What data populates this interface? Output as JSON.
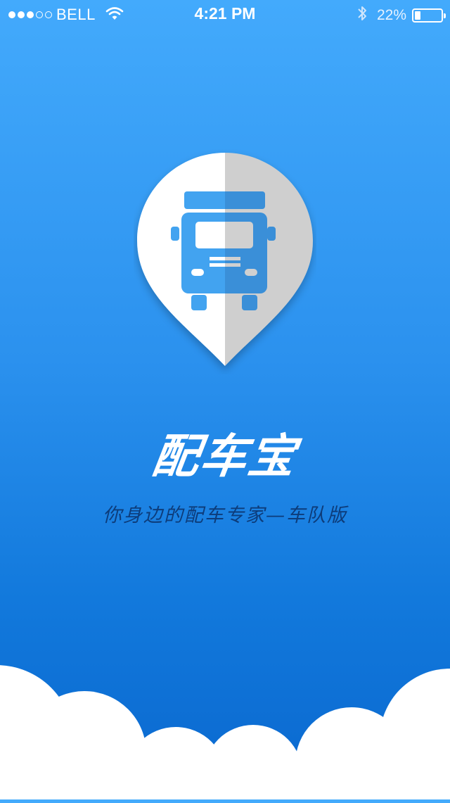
{
  "status_bar": {
    "signal_filled": 3,
    "signal_total": 5,
    "carrier": "BELL",
    "time": "4:21 PM",
    "battery_percent": "22%",
    "battery_level": 0.22,
    "icons": [
      "wifi-icon",
      "bluetooth-icon",
      "battery-icon"
    ]
  },
  "splash": {
    "logo_icon": "truck-location-pin-icon",
    "app_name": "配车宝",
    "tagline": "你身边的配车专家—车队版"
  },
  "colors": {
    "background_top": "#43aafc",
    "background_bottom": "#0a68cf",
    "truck_blue": "#42a3f0",
    "pin_light": "#ffffff",
    "pin_shade": "#cfcfcf",
    "tagline_color": "#0d3c7a",
    "clouds": "#ffffff"
  }
}
